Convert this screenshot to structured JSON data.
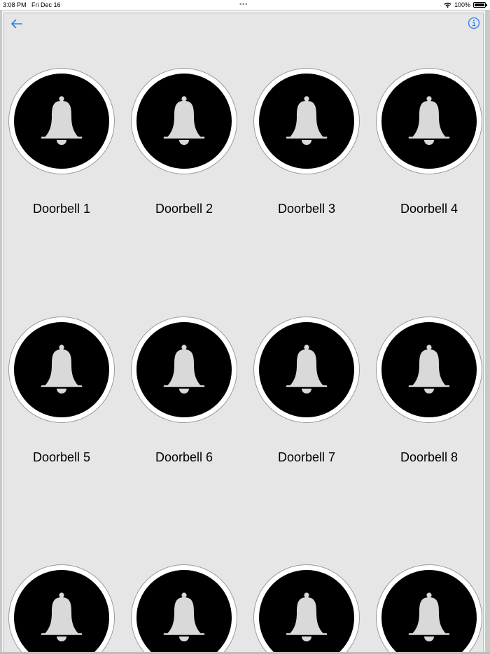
{
  "status_bar": {
    "time": "3:08 PM",
    "date": "Fri Dec 16",
    "dots": "•••",
    "battery_text": "100%"
  },
  "nav": {
    "back_icon": "arrow-left-icon",
    "info_icon": "info-circle-icon",
    "accent_color": "#2a7ef0"
  },
  "colors": {
    "background": "#e6e6e6",
    "circle": "#000000",
    "bell": "#d9d9d9",
    "ring": "#ffffff"
  },
  "doorbells": [
    {
      "label": "Doorbell 1"
    },
    {
      "label": "Doorbell 2"
    },
    {
      "label": "Doorbell 3"
    },
    {
      "label": "Doorbell 4"
    },
    {
      "label": "Doorbell 5"
    },
    {
      "label": "Doorbell 6"
    },
    {
      "label": "Doorbell 7"
    },
    {
      "label": "Doorbell 8"
    },
    {
      "label": ""
    },
    {
      "label": ""
    },
    {
      "label": ""
    },
    {
      "label": ""
    }
  ]
}
